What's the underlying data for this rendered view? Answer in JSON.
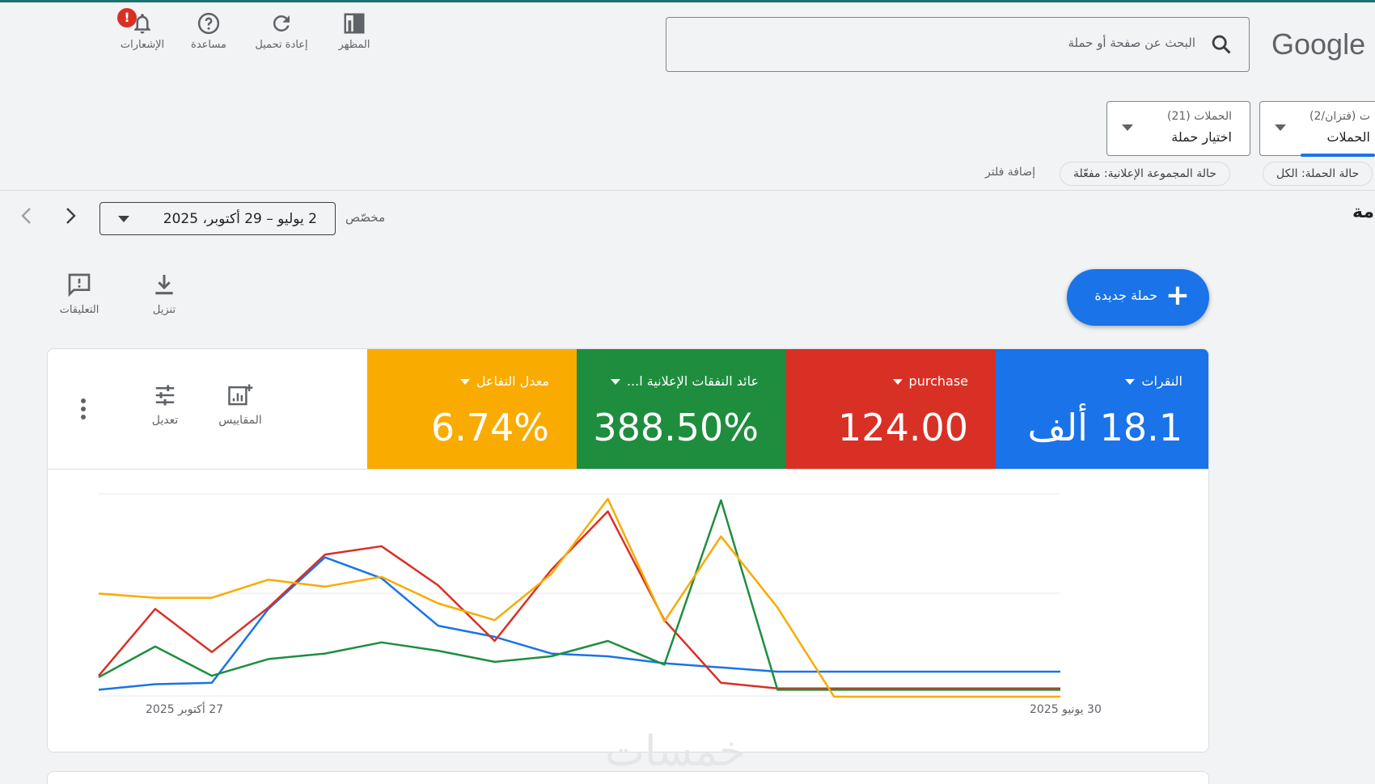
{
  "header": {
    "brand": "Google",
    "search_placeholder": "البحث عن صفحة أو حملة",
    "tools": [
      {
        "label": "الإشعارات",
        "icon": "bell-icon"
      },
      {
        "label": "مساعدة",
        "icon": "help-icon"
      },
      {
        "label": "إعادة تحميل",
        "icon": "refresh-icon"
      },
      {
        "label": "المظهر",
        "icon": "appearance-icon"
      }
    ]
  },
  "selectors": {
    "accounts": {
      "small": "ت (فتزان/2)",
      "big": "الحملات"
    },
    "campaigns": {
      "small": "الحملات (21)",
      "big": "اختيار حملة"
    }
  },
  "filters": {
    "chips": [
      "حالة الحملة: الكل",
      "حالة المجموعة الإعلانية: مفعّلة"
    ],
    "add_filter": "إضافة فلتر"
  },
  "page_title_fragment": "مة",
  "date_range": {
    "label": "مخصّص",
    "value": "2 يوليو – 29 أكتوبر، 2025"
  },
  "actions": {
    "feedback": "التعليقات",
    "download": "تنزيل",
    "new_campaign": "حملة جديدة"
  },
  "card": {
    "metrics": [
      {
        "name": "النقرات",
        "value": "18.1 ألف",
        "color": "#1a73e8"
      },
      {
        "name": "purchase",
        "value": "124.00",
        "color": "#d93025"
      },
      {
        "name": "عائد النفقات الإعلانية ا...",
        "value": "388.50%",
        "color": "#1e8e3e"
      },
      {
        "name": "معدل التفاعل",
        "value": "6.74%",
        "color": "#f9ab00"
      }
    ],
    "tools": {
      "metrics": "المقاييس",
      "adjust": "تعديل"
    }
  },
  "chart_data": {
    "type": "line",
    "x_start_label": "30 يونيو 2025",
    "x_end_label": "27 أكتوبر 2025",
    "grid": true,
    "series": [
      {
        "color": "#1a73e8",
        "values": [
          5,
          9,
          10,
          63,
          100,
          85,
          51,
          43,
          31,
          29,
          24,
          21,
          18,
          18,
          18,
          18,
          18,
          18
        ]
      },
      {
        "color": "#d93025",
        "values": [
          15,
          63,
          32,
          64,
          102,
          108,
          80,
          40,
          91,
          133,
          55,
          10,
          6,
          6,
          6,
          6,
          6,
          6
        ]
      },
      {
        "color": "#1e8e3e",
        "values": [
          14,
          36,
          15,
          27,
          31,
          39,
          33,
          25,
          29,
          40,
          23,
          141,
          5,
          5,
          5,
          5,
          5,
          5
        ]
      },
      {
        "color": "#f9ab00",
        "values": [
          74,
          71,
          71,
          84,
          79,
          86,
          67,
          55,
          88,
          142,
          54,
          115,
          64,
          0,
          0,
          0,
          0,
          0
        ]
      }
    ]
  },
  "watermark": "خمسات"
}
